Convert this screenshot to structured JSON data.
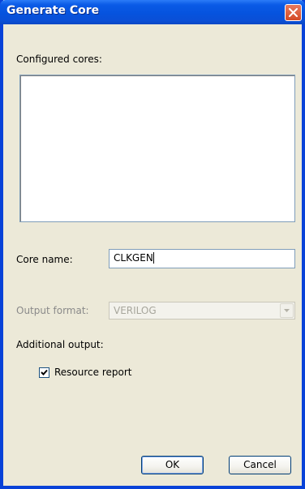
{
  "window": {
    "title": "Generate Core"
  },
  "form": {
    "configured_cores_label": "Configured cores:",
    "configured_cores_items": [],
    "core_name_label": "Core name:",
    "core_name_value": "CLKGEN",
    "output_format_label": "Output format:",
    "output_format_value": "VERILOG",
    "output_format_enabled": false,
    "additional_output_label": "Additional output:",
    "resource_report_label": "Resource report",
    "resource_report_checked": true
  },
  "buttons": {
    "ok_label": "OK",
    "cancel_label": "Cancel"
  },
  "icons": {
    "close": "close-icon",
    "dropdown": "chevron-down-icon",
    "check": "checkmark-icon"
  },
  "colors": {
    "titlebar": "#0653de",
    "dialog_background": "#ece9d8",
    "close_button": "#d34a25"
  }
}
